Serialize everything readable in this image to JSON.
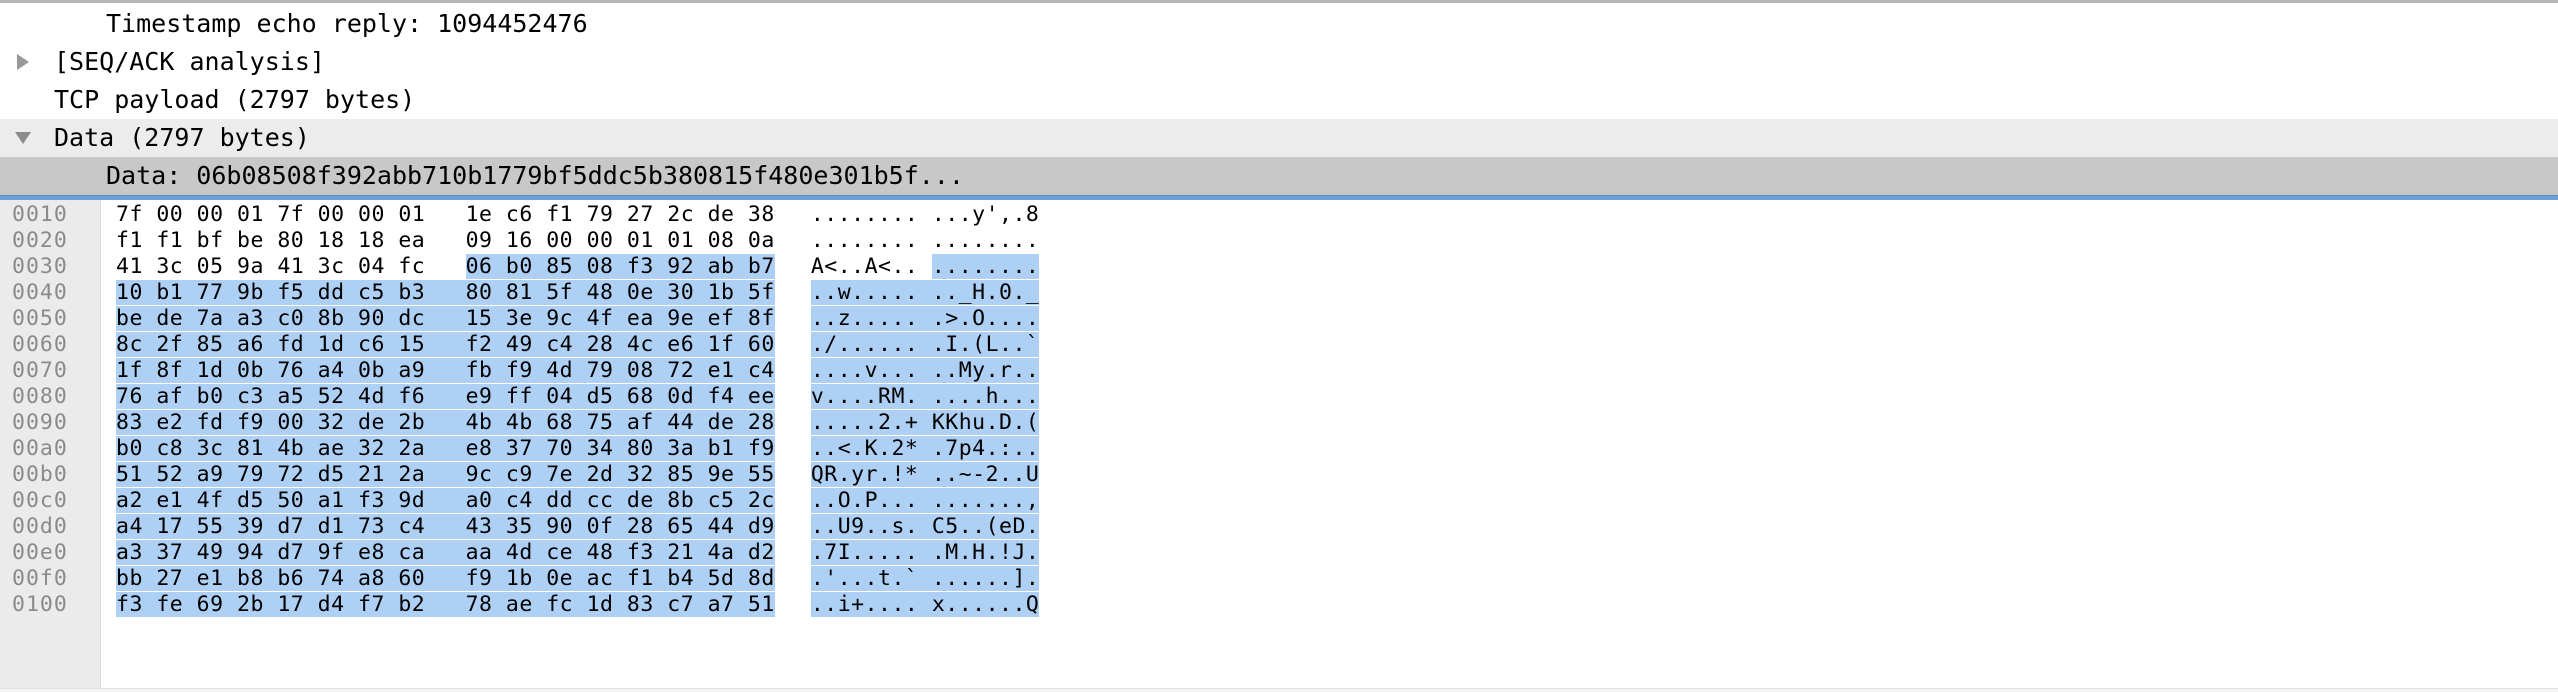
{
  "detail_tree": {
    "rows": [
      {
        "id": "timestamp-echo-reply",
        "twisty": "none",
        "indent": "indent-3",
        "label": "Timestamp echo reply: 1094452476",
        "state": "normal"
      },
      {
        "id": "seq-ack-analysis",
        "twisty": "right",
        "indent": "indent-2",
        "label": "[SEQ/ACK analysis]",
        "state": "normal"
      },
      {
        "id": "tcp-payload",
        "twisty": "none",
        "indent": "indent-2",
        "label": "TCP payload (2797 bytes)",
        "state": "normal"
      },
      {
        "id": "data-node",
        "twisty": "down",
        "indent": "indent-1",
        "label": "Data (2797 bytes)",
        "state": "expanded"
      },
      {
        "id": "data-field",
        "twisty": "none",
        "indent": "indent-3",
        "label": "Data: 06b08508f392abb710b1779bf5ddc5b380815f480e301b5f...",
        "state": "selected"
      }
    ]
  },
  "colors": {
    "selection_highlight": "#aed0f5",
    "selected_row_background": "#c8c8c8",
    "expanded_row_background": "#ececec",
    "offset_gutter_background": "#ebebeb",
    "offset_text": "#8a8a8a",
    "pane_divider": "#6f9fd8"
  },
  "hex_dump": {
    "rows": [
      {
        "offset": "0010",
        "hex_left": "7f 00 00 01",
        "hex_mid": "7f 00 00 01",
        "hex_right1": "1e c6 f1 79",
        "hex_right2": "27 2c de 38",
        "ascii_left": "........",
        "ascii_right": "...y',.8",
        "selection": "none"
      },
      {
        "offset": "0020",
        "hex_left": "f1 f1 bf be",
        "hex_mid": "80 18 18 ea",
        "hex_right1": "09 16 00 00",
        "hex_right2": "01 01 08 0a",
        "ascii_left": "........",
        "ascii_right": "........",
        "selection": "none"
      },
      {
        "offset": "0030",
        "hex_left": "41 3c 05 9a",
        "hex_mid": "41 3c 04 fc",
        "hex_right1": "06 b0 85 08",
        "hex_right2": "f3 92 ab b7",
        "ascii_left": "A<..A<..",
        "ascii_right": "........",
        "selection": "right-half"
      },
      {
        "offset": "0040",
        "hex_left": "10 b1 77 9b",
        "hex_mid": "f5 dd c5 b3",
        "hex_right1": "80 81 5f 48",
        "hex_right2": "0e 30 1b 5f",
        "ascii_left": "..w.....",
        "ascii_right": ".._H.0._",
        "selection": "full"
      },
      {
        "offset": "0050",
        "hex_left": "be de 7a a3",
        "hex_mid": "c0 8b 90 dc",
        "hex_right1": "15 3e 9c 4f",
        "hex_right2": "ea 9e ef 8f",
        "ascii_left": "..z.....",
        "ascii_right": ".>.O....",
        "selection": "full"
      },
      {
        "offset": "0060",
        "hex_left": "8c 2f 85 a6",
        "hex_mid": "fd 1d c6 15",
        "hex_right1": "f2 49 c4 28",
        "hex_right2": "4c e6 1f 60",
        "ascii_left": "./......",
        "ascii_right": ".I.(L..`",
        "selection": "full"
      },
      {
        "offset": "0070",
        "hex_left": "1f 8f 1d 0b",
        "hex_mid": "76 a4 0b a9",
        "hex_right1": "fb f9 4d 79",
        "hex_right2": "08 72 e1 c4",
        "ascii_left": "....v...",
        "ascii_right": "..My.r..",
        "selection": "full"
      },
      {
        "offset": "0080",
        "hex_left": "76 af b0 c3",
        "hex_mid": "a5 52 4d f6",
        "hex_right1": "e9 ff 04 d5",
        "hex_right2": "68 0d f4 ee",
        "ascii_left": "v....RM.",
        "ascii_right": "....h...",
        "selection": "full"
      },
      {
        "offset": "0090",
        "hex_left": "83 e2 fd f9",
        "hex_mid": "00 32 de 2b",
        "hex_right1": "4b 4b 68 75",
        "hex_right2": "af 44 de 28",
        "ascii_left": ".....2.+",
        "ascii_right": "KKhu.D.(",
        "selection": "full"
      },
      {
        "offset": "00a0",
        "hex_left": "b0 c8 3c 81",
        "hex_mid": "4b ae 32 2a",
        "hex_right1": "e8 37 70 34",
        "hex_right2": "80 3a b1 f9",
        "ascii_left": "..<.K.2*",
        "ascii_right": ".7p4.:..",
        "selection": "full"
      },
      {
        "offset": "00b0",
        "hex_left": "51 52 a9 79",
        "hex_mid": "72 d5 21 2a",
        "hex_right1": "9c c9 7e 2d",
        "hex_right2": "32 85 9e 55",
        "ascii_left": "QR.yr.!*",
        "ascii_right": "..~-2..U",
        "selection": "full"
      },
      {
        "offset": "00c0",
        "hex_left": "a2 e1 4f d5",
        "hex_mid": "50 a1 f3 9d",
        "hex_right1": "a0 c4 dd cc",
        "hex_right2": "de 8b c5 2c",
        "ascii_left": "..O.P...",
        "ascii_right": ".......,",
        "selection": "full"
      },
      {
        "offset": "00d0",
        "hex_left": "a4 17 55 39",
        "hex_mid": "d7 d1 73 c4",
        "hex_right1": "43 35 90 0f",
        "hex_right2": "28 65 44 d9",
        "ascii_left": "..U9..s.",
        "ascii_right": "C5..(eD.",
        "selection": "full"
      },
      {
        "offset": "00e0",
        "hex_left": "a3 37 49 94",
        "hex_mid": "d7 9f e8 ca",
        "hex_right1": "aa 4d ce 48",
        "hex_right2": "f3 21 4a d2",
        "ascii_left": ".7I.....",
        "ascii_right": ".M.H.!J.",
        "selection": "full"
      },
      {
        "offset": "00f0",
        "hex_left": "bb 27 e1 b8",
        "hex_mid": "b6 74 a8 60",
        "hex_right1": "f9 1b 0e ac",
        "hex_right2": "f1 b4 5d 8d",
        "ascii_left": ".'...t.`",
        "ascii_right": "......].",
        "selection": "full"
      },
      {
        "offset": "0100",
        "hex_left": "f3 fe 69 2b",
        "hex_mid": "17 d4 f7 b2",
        "hex_right1": "78 ae fc 1d",
        "hex_right2": "83 c7 a7 51",
        "ascii_left": "..i+....",
        "ascii_right": "x......Q",
        "selection": "full"
      }
    ]
  }
}
